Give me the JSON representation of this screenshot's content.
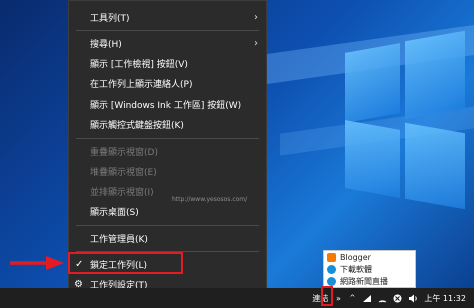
{
  "menu": {
    "items": [
      {
        "label": "工具列(T)",
        "has_submenu": true,
        "disabled": false
      },
      {
        "label": "搜尋(H)",
        "has_submenu": true,
        "disabled": false
      },
      {
        "label": "顯示 [工作檢視] 按鈕(V)",
        "has_submenu": false,
        "disabled": false
      },
      {
        "label": "在工作列上顯示連絡人(P)",
        "has_submenu": false,
        "disabled": false
      },
      {
        "label": "顯示 [Windows Ink 工作區] 按鈕(W)",
        "has_submenu": false,
        "disabled": false
      },
      {
        "label": "顯示觸控式鍵盤按鈕(K)",
        "has_submenu": false,
        "disabled": false
      },
      {
        "label": "重疊顯示視窗(D)",
        "has_submenu": false,
        "disabled": true
      },
      {
        "label": "堆疊顯示視窗(E)",
        "has_submenu": false,
        "disabled": true
      },
      {
        "label": "並排顯示視窗(I)",
        "has_submenu": false,
        "disabled": true
      },
      {
        "label": "顯示桌面(S)",
        "has_submenu": false,
        "disabled": false
      },
      {
        "label": "工作管理員(K)",
        "has_submenu": false,
        "disabled": false
      },
      {
        "label": "鎖定工作列(L)",
        "has_submenu": false,
        "disabled": false,
        "checked": true
      },
      {
        "label": "工作列設定(T)",
        "has_submenu": false,
        "disabled": false,
        "icon": "gear-icon"
      }
    ],
    "submenu_arrow": "›",
    "check_mark": "✓",
    "gear_glyph": "⚙"
  },
  "tray_popup": {
    "items": [
      {
        "label": "Blogger",
        "icon": "blogger-icon",
        "color": "#f57c00"
      },
      {
        "label": "下載軟體",
        "icon": "edge-icon",
        "color": "#1a8fd8"
      },
      {
        "label": "網路新聞直播",
        "icon": "edge-icon",
        "color": "#1a8fd8"
      }
    ]
  },
  "taskbar": {
    "links_label": "連結",
    "overflow_chevron": "»",
    "chevron_up": "^",
    "clock": "上午 11:32"
  },
  "watermark": "http://www.yesosos.com/",
  "colors": {
    "menu_bg": "#2b2b2b",
    "highlight": "#e41b23",
    "taskbar_bg": "#1f1f1f"
  }
}
